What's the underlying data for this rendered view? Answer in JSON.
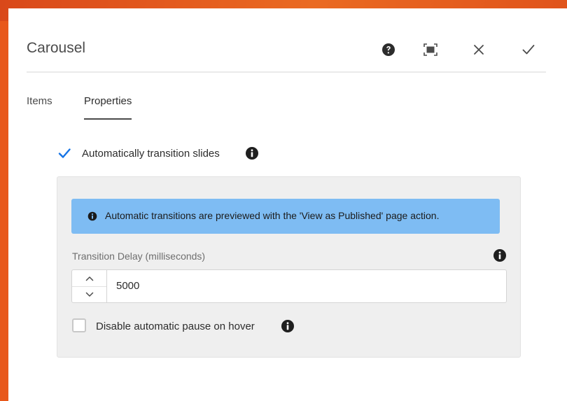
{
  "dialog": {
    "title": "Carousel",
    "actions": {
      "help": "help-icon",
      "fullscreen": "fullscreen-icon",
      "close": "close-icon",
      "done": "checkmark-icon"
    }
  },
  "tabs": [
    {
      "label": "Items",
      "active": false
    },
    {
      "label": "Properties",
      "active": true
    }
  ],
  "properties": {
    "auto_transition": {
      "label": "Automatically transition slides",
      "checked": true
    },
    "alert": {
      "text": "Automatic transitions are previewed with the 'View as Published' page action."
    },
    "transition_delay": {
      "label": "Transition Delay (milliseconds)",
      "value": "5000"
    },
    "disable_pause": {
      "label": "Disable automatic pause on hover",
      "checked": false
    }
  },
  "colors": {
    "background": "#e8581b",
    "accent": "#1473e6",
    "alert_bg": "#7ebcf3"
  }
}
